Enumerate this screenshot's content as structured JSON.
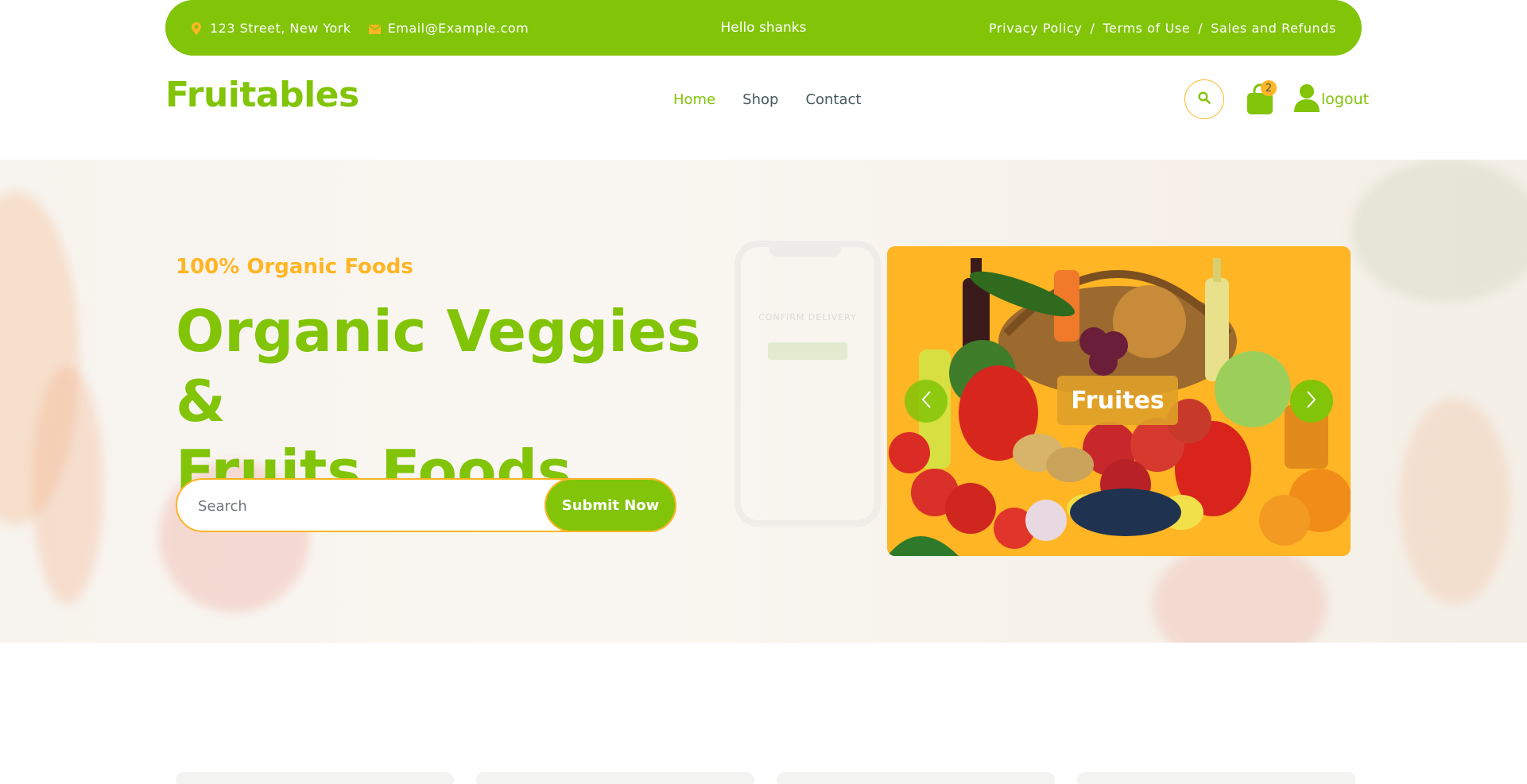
{
  "topbar": {
    "address": "123 Street, New York",
    "email": "Email@Example.com",
    "greeting": "Hello shanks",
    "links": [
      "Privacy Policy",
      "Terms of Use",
      "Sales and Refunds"
    ],
    "separator": "/"
  },
  "header": {
    "logo": "Fruitables",
    "nav": [
      "Home",
      "Shop",
      "Contact"
    ],
    "cart_count": "2",
    "logout_label": "logout"
  },
  "hero": {
    "subtitle": "100% Organic Foods",
    "title_line1": "Organic Veggies &",
    "title_line2": "Fruits Foods",
    "search_placeholder": "Search",
    "submit_label": "Submit Now",
    "phone_text": "CONFIRM DELIVERY",
    "carousel_label": "Fruites"
  },
  "colors": {
    "primary": "#81c408",
    "secondary": "#ffb524",
    "text": "#45595b"
  },
  "icons": {
    "address": "map-marker-icon",
    "email": "envelope-icon",
    "search": "search-icon",
    "cart": "shopping-bag-icon",
    "user": "user-icon",
    "prev": "chevron-left-icon",
    "next": "chevron-right-icon"
  }
}
